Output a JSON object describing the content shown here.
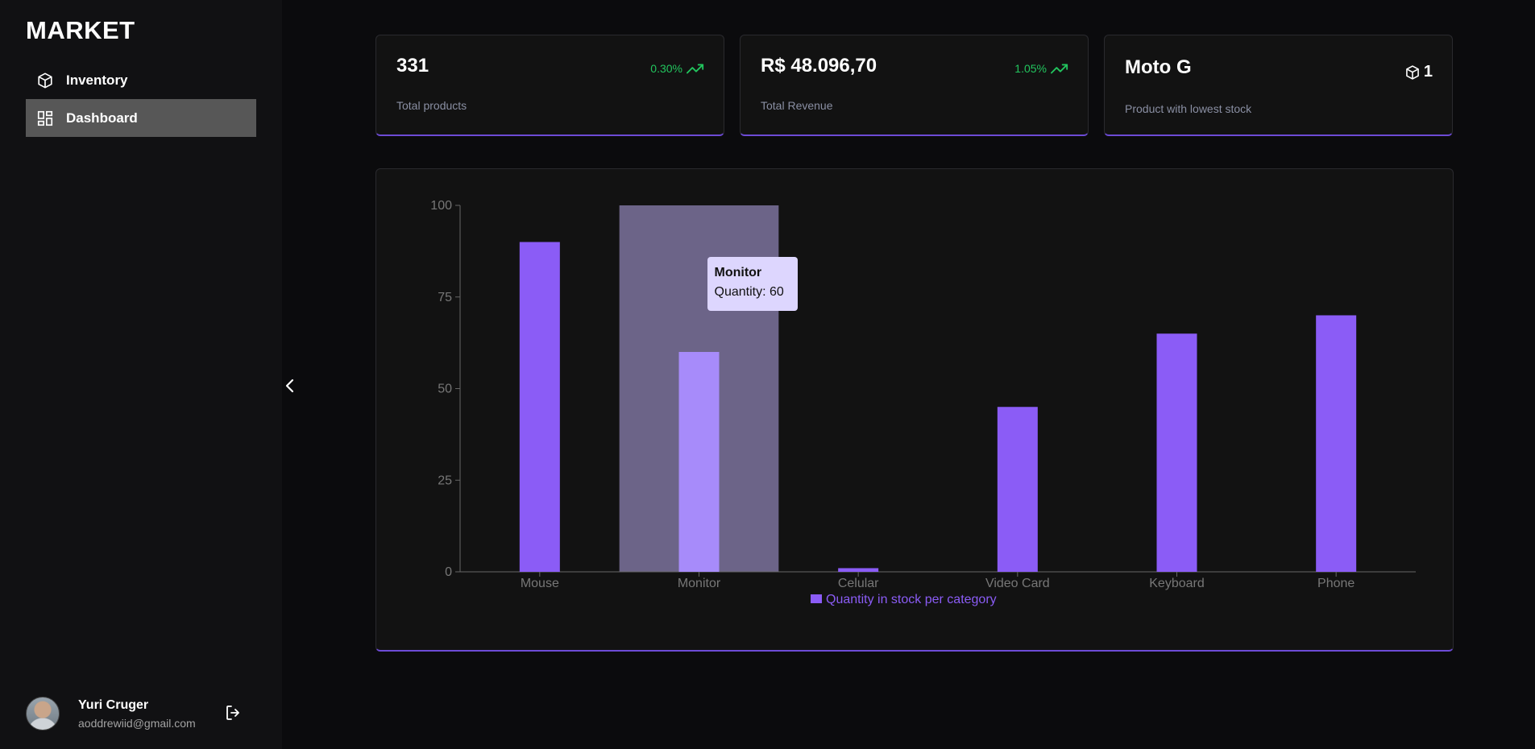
{
  "sidebar": {
    "brand": "MARKET",
    "items": [
      {
        "label": "Inventory",
        "icon": "box-icon",
        "active": false
      },
      {
        "label": "Dashboard",
        "icon": "dashboard-grid-icon",
        "active": true
      }
    ],
    "user": {
      "name": "Yuri Cruger",
      "email": "aoddrewiid@gmail.com"
    }
  },
  "cards": [
    {
      "value": "331",
      "label": "Total products",
      "trend": "0.30%",
      "trend_icon": "trending-up-icon"
    },
    {
      "value": "R$ 48.096,70",
      "label": "Total Revenue",
      "trend": "1.05%",
      "trend_icon": "trending-up-icon"
    },
    {
      "value": "Moto G",
      "label": "Product with lowest stock",
      "stock": "1",
      "stock_icon": "box-icon"
    }
  ],
  "tooltip": {
    "title": "Monitor",
    "text": "Quantity: 60"
  },
  "colors": {
    "accent": "#8b5cf6",
    "bar_active": "#a78bfa",
    "highlight": "#6c6488",
    "positive": "#22c55e",
    "tooltip_bg": "#ddd6fe"
  },
  "chart_data": {
    "type": "bar",
    "categories": [
      "Mouse",
      "Monitor",
      "Celular",
      "Video Card",
      "Keyboard",
      "Phone"
    ],
    "series": [
      {
        "name": "Quantity in stock per category",
        "values": [
          90,
          60,
          1,
          45,
          65,
          70
        ]
      }
    ],
    "ylim": [
      0,
      100
    ],
    "yticks": [
      0,
      25,
      50,
      75,
      100
    ],
    "active_category": "Monitor",
    "legend": "bottom",
    "grid": false
  }
}
